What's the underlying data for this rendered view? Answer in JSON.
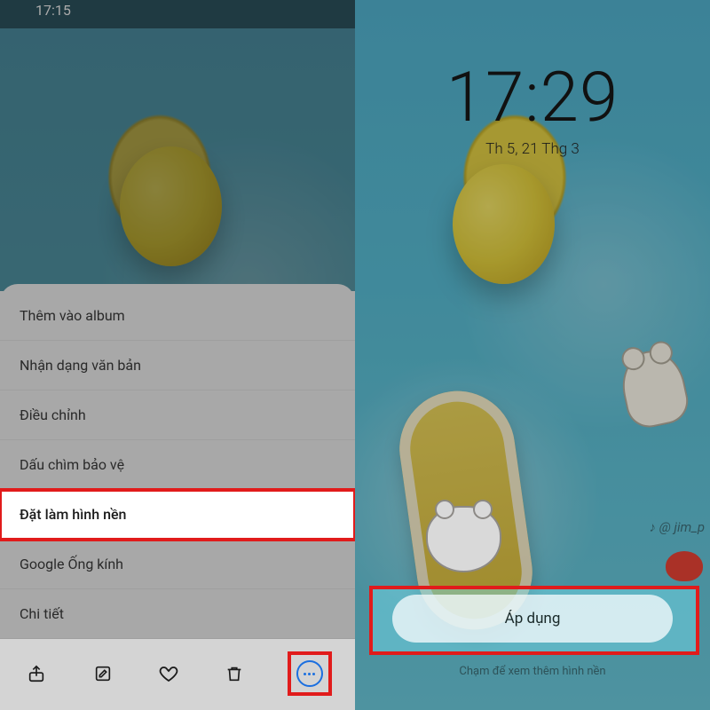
{
  "left": {
    "status_time": "17:15",
    "menu": {
      "items": [
        "Thêm vào album",
        "Nhận dạng văn bản",
        "Điều chỉnh",
        "Dấu chìm bảo vệ",
        "Đặt làm hình nền",
        "Google Ống kính",
        "Chi tiết"
      ]
    },
    "toolbar": {
      "share": "share-icon",
      "edit": "edit-icon",
      "favorite": "heart-icon",
      "delete": "trash-icon",
      "more": "more-icon"
    }
  },
  "right": {
    "time": "17:29",
    "date": "Th 5, 21 Thg 3",
    "watermark": "♪ @ jim_p",
    "apply_label": "Áp dụng",
    "hint": "Chạm để xem thêm hình nền"
  }
}
